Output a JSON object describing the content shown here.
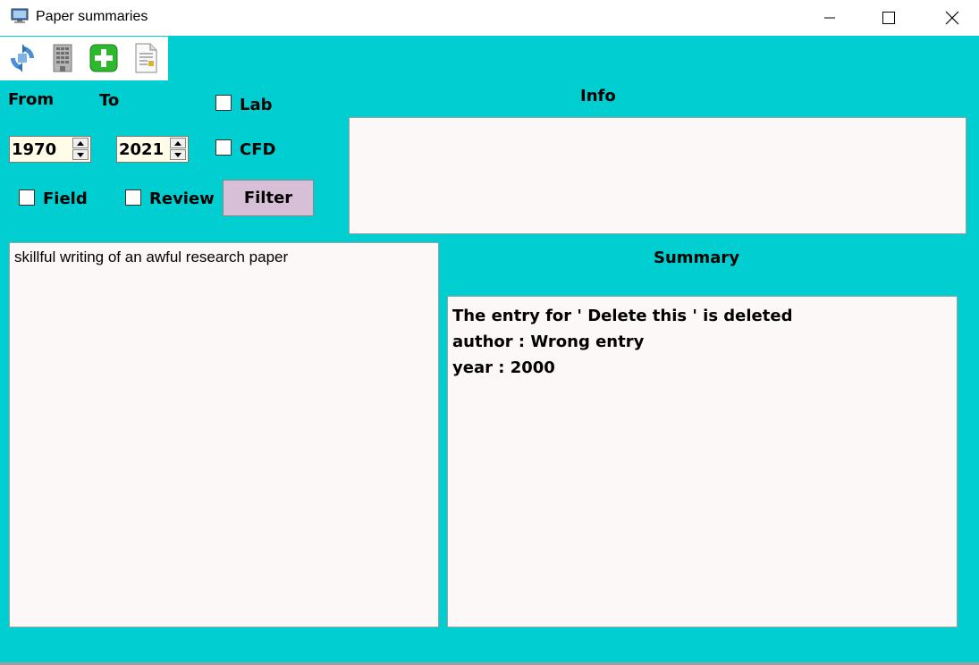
{
  "window": {
    "title": "Paper summaries",
    "icons": [
      "app-monitor-icon",
      "minimize-icon",
      "maximize-icon",
      "close-icon"
    ]
  },
  "toolbar": {
    "items": [
      {
        "name": "refresh-icon"
      },
      {
        "name": "building-icon"
      },
      {
        "name": "add-icon"
      },
      {
        "name": "document-icon"
      }
    ]
  },
  "filters": {
    "from_label": "From",
    "to_label": "To",
    "from_value": "1970",
    "to_value": "2021",
    "lab_label": "Lab",
    "cfd_label": "CFD",
    "field_label": "Field",
    "review_label": "Review",
    "lab_checked": false,
    "cfd_checked": false,
    "field_checked": false,
    "review_checked": false,
    "filter_button": "Filter"
  },
  "info": {
    "heading": "Info",
    "text": ""
  },
  "papers": {
    "items": [
      "skillful writing of an awful research paper"
    ]
  },
  "summary": {
    "heading": "Summary",
    "lines": [
      "The entry for ' Delete this ' is deleted",
      "author : Wrong entry",
      "year : 2000"
    ]
  },
  "colors": {
    "background": "#00ced1",
    "textbox": "#fdf8f8",
    "spinbox": "#fffde7",
    "filter_button": "#d8bfd8"
  }
}
